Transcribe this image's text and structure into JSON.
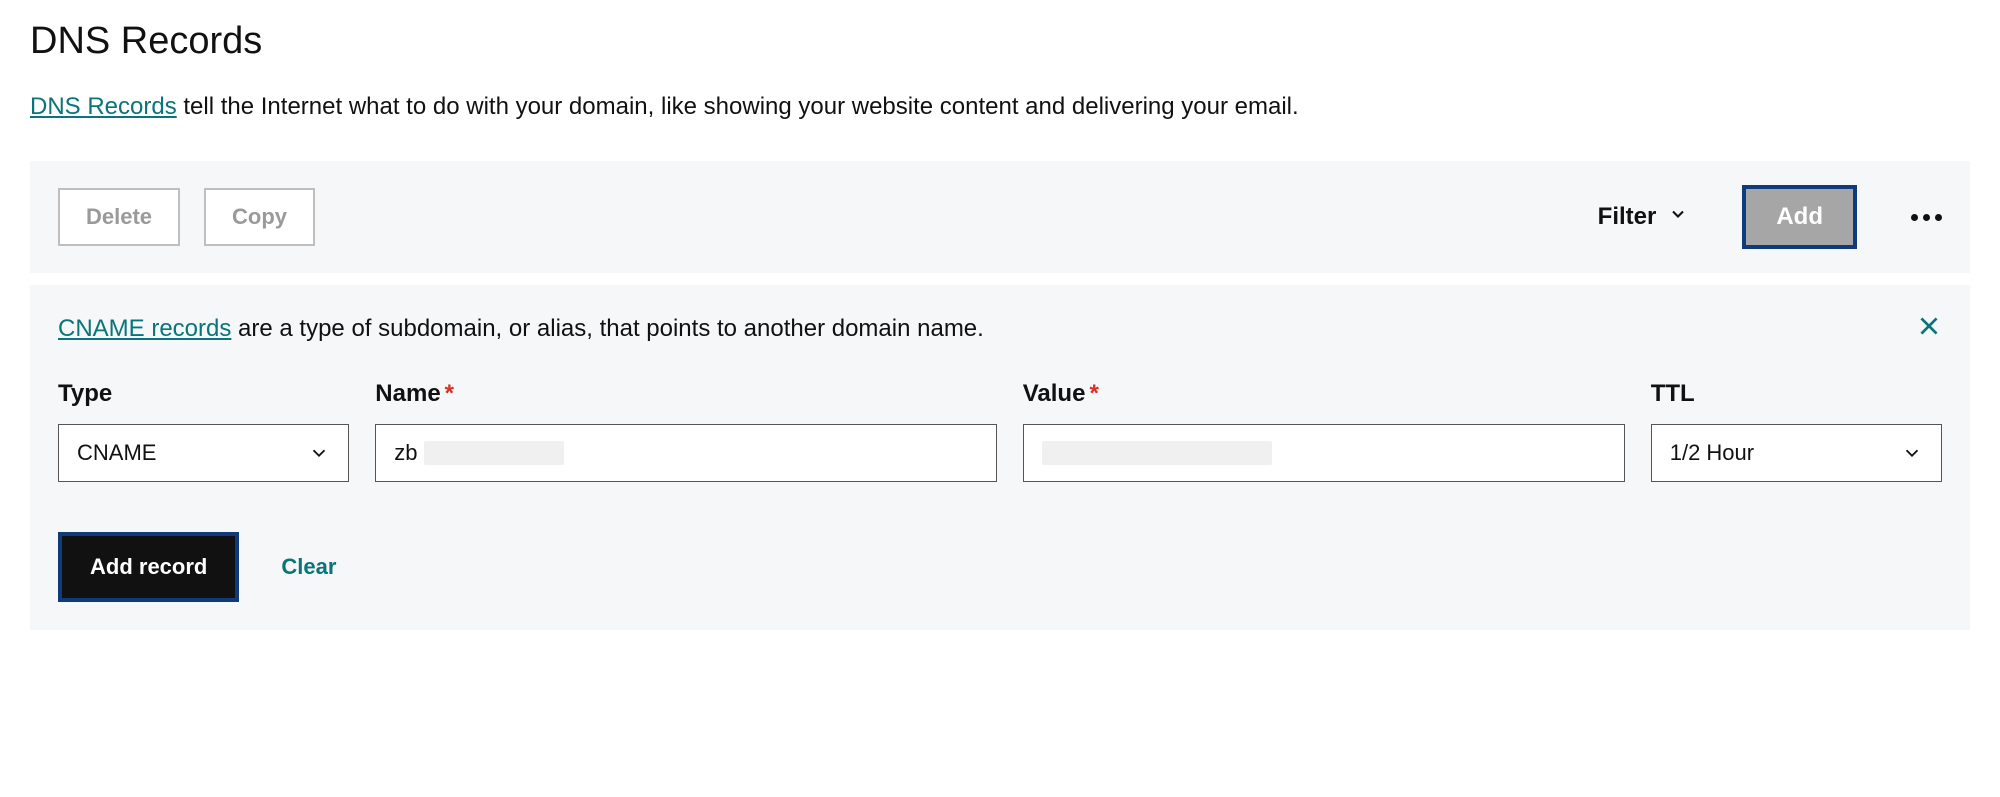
{
  "header": {
    "title": "DNS Records",
    "description_link": "DNS Records",
    "description_rest": " tell the Internet what to do with your domain, like showing your website content and delivering your email."
  },
  "toolbar": {
    "delete_label": "Delete",
    "copy_label": "Copy",
    "filter_label": "Filter",
    "add_label": "Add"
  },
  "form": {
    "info_link": "CNAME records",
    "info_rest": " are a type of subdomain, or alias, that points to another domain name.",
    "labels": {
      "type": "Type",
      "name": "Name",
      "value": "Value",
      "ttl": "TTL"
    },
    "type_value": "CNAME",
    "name_value": "zb",
    "ttl_value": "1/2 Hour",
    "add_record_label": "Add record",
    "clear_label": "Clear"
  }
}
